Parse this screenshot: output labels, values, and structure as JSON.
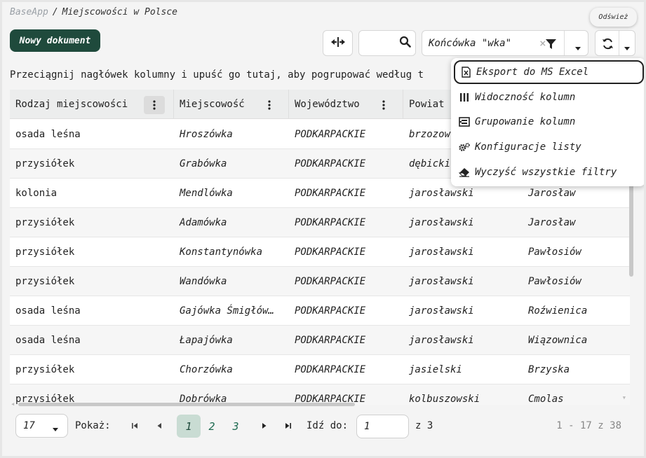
{
  "breadcrumb": {
    "app": "BaseApp",
    "separator": "/",
    "page": "Miejscowości w Polsce"
  },
  "toolbar": {
    "new_document_label": "Nowy dokument",
    "search_value": "",
    "filter_value": "Końcówka \"wka\"",
    "clear_symbol": "×",
    "refresh_tooltip": "Odśwież"
  },
  "group_hint": "Przeciągnij nagłówek kolumny i upuść go tutaj, aby pogrupować według t",
  "columns": [
    {
      "label": "Rodzaj miejscowości"
    },
    {
      "label": "Miejscowość"
    },
    {
      "label": "Województwo"
    },
    {
      "label": "Powiat"
    },
    {
      "label": ""
    }
  ],
  "rows": [
    [
      "osada leśna",
      "Hroszówka",
      "PODKARPACKIE",
      "brzozow",
      ""
    ],
    [
      "przysiółek",
      "Grabówka",
      "PODKARPACKIE",
      "dębicki",
      ""
    ],
    [
      "kolonia",
      "Mendlówka",
      "PODKARPACKIE",
      "jarosławski",
      "Jarosław"
    ],
    [
      "przysiółek",
      "Adamówka",
      "PODKARPACKIE",
      "jarosławski",
      "Jarosław"
    ],
    [
      "przysiółek",
      "Konstantynówka",
      "PODKARPACKIE",
      "jarosławski",
      "Pawłosiów"
    ],
    [
      "przysiółek",
      "Wandówka",
      "PODKARPACKIE",
      "jarosławski",
      "Pawłosiów"
    ],
    [
      "osada leśna",
      "Gajówka Śmigłów…",
      "PODKARPACKIE",
      "jarosławski",
      "Roźwienica"
    ],
    [
      "osada leśna",
      "Łapajówka",
      "PODKARPACKIE",
      "jarosławski",
      "Wiązownica"
    ],
    [
      "przysiółek",
      "Chorzówka",
      "PODKARPACKIE",
      "jasielski",
      "Brzyska"
    ],
    [
      "przysiółek",
      "Dobrówka",
      "PODKARPACKIE",
      "kolbuszowski",
      "Cmolas"
    ]
  ],
  "menu": {
    "items": [
      {
        "label": "Eksport do MS Excel",
        "icon": "excel-file-icon"
      },
      {
        "label": "Widoczność kolumn",
        "icon": "columns-icon"
      },
      {
        "label": "Grupowanie kolumn",
        "icon": "group-columns-icon"
      },
      {
        "label": "Konfiguracje listy",
        "icon": "gears-icon"
      },
      {
        "label": "Wyczyść wszystkie filtry",
        "icon": "eraser-icon"
      }
    ]
  },
  "pager": {
    "page_size": "17",
    "show_label": "Pokaż:",
    "pages": [
      "1",
      "2",
      "3"
    ],
    "current_page": "1",
    "goto_label": "Idź do:",
    "goto_value": "1",
    "of_total": "z 3",
    "range": "1 - 17 z 38"
  },
  "colors": {
    "primary": "#1f4a3c",
    "current_page_bg": "#c9dcd3",
    "header_bg": "#eceded"
  }
}
